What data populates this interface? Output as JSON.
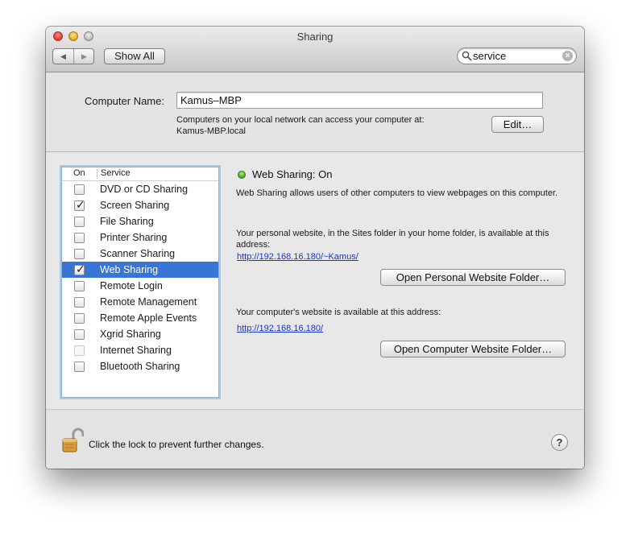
{
  "window": {
    "title": "Sharing"
  },
  "toolbar": {
    "back_icon": "◀",
    "forward_icon": "▶",
    "show_all_label": "Show All",
    "search_value": "service"
  },
  "computer_name": {
    "label": "Computer Name:",
    "value": "Kamus–MBP",
    "description_line1": "Computers on your local network can access your computer at:",
    "description_line2": "Kamus-MBP.local",
    "edit_label": "Edit…"
  },
  "services": {
    "header_on": "On",
    "header_service": "Service",
    "items": [
      {
        "label": "DVD or CD Sharing",
        "checked": false,
        "selected": false,
        "enabled": true
      },
      {
        "label": "Screen Sharing",
        "checked": true,
        "selected": false,
        "enabled": true
      },
      {
        "label": "File Sharing",
        "checked": false,
        "selected": false,
        "enabled": true
      },
      {
        "label": "Printer Sharing",
        "checked": false,
        "selected": false,
        "enabled": true
      },
      {
        "label": "Scanner Sharing",
        "checked": false,
        "selected": false,
        "enabled": true
      },
      {
        "label": "Web Sharing",
        "checked": true,
        "selected": true,
        "enabled": true
      },
      {
        "label": "Remote Login",
        "checked": false,
        "selected": false,
        "enabled": true
      },
      {
        "label": "Remote Management",
        "checked": false,
        "selected": false,
        "enabled": true
      },
      {
        "label": "Remote Apple Events",
        "checked": false,
        "selected": false,
        "enabled": true
      },
      {
        "label": "Xgrid Sharing",
        "checked": false,
        "selected": false,
        "enabled": true
      },
      {
        "label": "Internet Sharing",
        "checked": false,
        "selected": false,
        "enabled": false
      },
      {
        "label": "Bluetooth Sharing",
        "checked": false,
        "selected": false,
        "enabled": true
      }
    ]
  },
  "detail": {
    "status_title": "Web Sharing: On",
    "status_color": "#46b22a",
    "description": "Web Sharing allows users of other computers to view webpages on this computer.",
    "personal_desc": "Your personal website, in the Sites folder in your home folder, is available at this address:",
    "personal_url": "http://192.168.16.180/~Kamus/",
    "open_personal_label": "Open Personal Website Folder…",
    "computer_desc": "Your computer's website is available at this address:",
    "computer_url": "http://192.168.16.180/",
    "open_computer_label": "Open Computer Website Folder…"
  },
  "footer": {
    "lock_text": "Click the lock to prevent further changes.",
    "help_label": "?"
  }
}
